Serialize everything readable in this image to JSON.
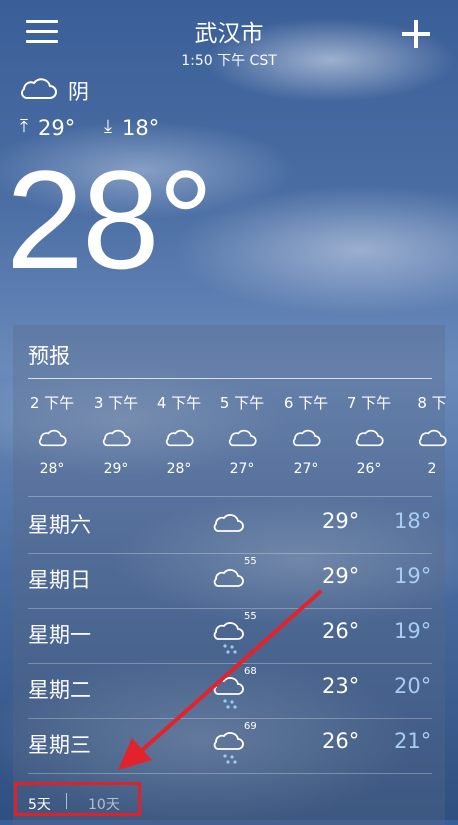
{
  "header": {
    "city": "武汉市",
    "time": "1:50 下午 CST"
  },
  "current": {
    "condition": "阴",
    "condition_icon": "cloud-icon",
    "high": "29°",
    "low": "18°",
    "temp": "28°"
  },
  "forecast": {
    "title": "预报",
    "hourly": [
      {
        "label": "2 下午",
        "temp": "28°",
        "icon": "cloud-icon"
      },
      {
        "label": "3 下午",
        "temp": "29°",
        "icon": "cloud-icon"
      },
      {
        "label": "4 下午",
        "temp": "28°",
        "icon": "cloud-icon"
      },
      {
        "label": "5 下午",
        "temp": "27°",
        "icon": "cloud-icon"
      },
      {
        "label": "6 下午",
        "temp": "27°",
        "icon": "cloud-icon"
      },
      {
        "label": "7 下午",
        "temp": "26°",
        "icon": "cloud-icon"
      },
      {
        "label": "8 下",
        "temp": "2",
        "icon": "cloud-icon"
      }
    ],
    "daily": [
      {
        "day": "星期六",
        "icon": "cloud-icon",
        "precip": "",
        "high": "29°",
        "low": "18°"
      },
      {
        "day": "星期日",
        "icon": "cloud-icon",
        "precip": "55",
        "high": "29°",
        "low": "19°"
      },
      {
        "day": "星期一",
        "icon": "rain-cloud-icon",
        "precip": "55",
        "high": "26°",
        "low": "19°"
      },
      {
        "day": "星期二",
        "icon": "rain-cloud-icon",
        "precip": "68",
        "high": "23°",
        "low": "20°"
      },
      {
        "day": "星期三",
        "icon": "rain-cloud-icon",
        "precip": "69",
        "high": "26°",
        "low": "21°"
      }
    ],
    "tabs": {
      "five_day": "5天",
      "ten_day": "10天"
    }
  },
  "colors": {
    "low_temp": "#a9cdf1",
    "highlight": "#e0212a"
  }
}
